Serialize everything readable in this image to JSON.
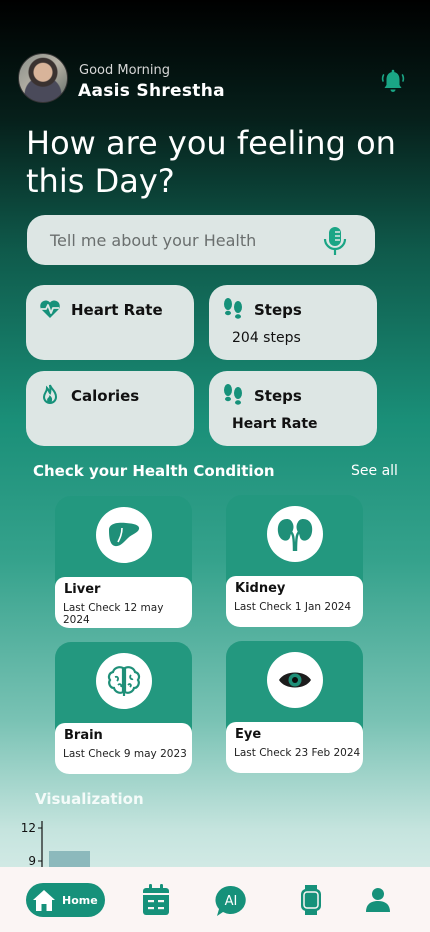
{
  "header": {
    "greeting": "Good Morning",
    "user_name": "Aasis Shrestha",
    "avatar": "user-photo",
    "notification_icon": "bell-icon"
  },
  "headline": "How are you feeling on this Day?",
  "search": {
    "placeholder": "Tell me about your Health",
    "icon": "microphone-icon"
  },
  "metrics": [
    {
      "title": "Heart Rate",
      "value": "",
      "icon": "heart-pulse-icon"
    },
    {
      "title": "Steps",
      "value": "204 steps",
      "icon": "footprints-icon"
    },
    {
      "title": "Calories",
      "value": "",
      "icon": "flame-icon"
    },
    {
      "title": "Steps",
      "value": "Heart Rate",
      "icon": "footprints-icon"
    }
  ],
  "health_section": {
    "title": "Check your Health Condition",
    "see_all": "See all",
    "organs": [
      {
        "name": "Liver",
        "last_check": "Last Check 12 may 2024",
        "icon": "liver-icon"
      },
      {
        "name": "Kidney",
        "last_check": "Last Check 1 Jan 2024",
        "icon": "kidney-icon"
      },
      {
        "name": "Brain",
        "last_check": "Last Check 9 may 2023",
        "icon": "brain-icon"
      },
      {
        "name": "Eye",
        "last_check": "Last Check 23 Feb 2024",
        "icon": "eye-icon"
      }
    ]
  },
  "visualization": {
    "title": "Visualization"
  },
  "chart_data": {
    "type": "bar",
    "categories": [
      ""
    ],
    "values": [
      9
    ],
    "yticks": [
      "12",
      "9"
    ],
    "ylim": [
      9,
      12
    ]
  },
  "navbar": {
    "home_label": "Home",
    "ai_label": "AI",
    "items": [
      "home-icon",
      "calendar-icon",
      "ai-chat-icon",
      "smartwatch-icon",
      "profile-icon"
    ]
  },
  "colors": {
    "accent": "#16917a",
    "card": "#dde6e4",
    "organ_card": "#23987f"
  }
}
